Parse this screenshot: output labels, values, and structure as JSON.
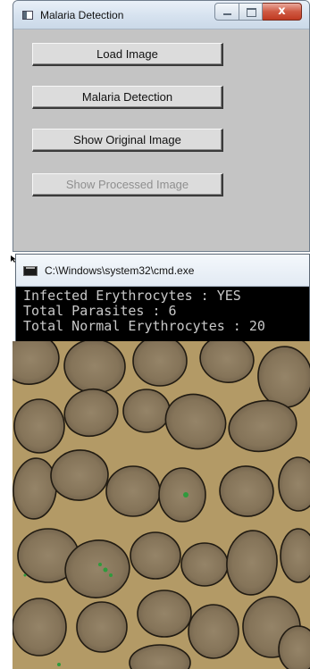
{
  "app_window": {
    "title": "Malaria Detection",
    "buttons": [
      {
        "label": "Load Image",
        "enabled": true
      },
      {
        "label": "Malaria Detection",
        "enabled": true
      },
      {
        "label": "Show Original Image",
        "enabled": true
      },
      {
        "label": "Show Processed Image",
        "enabled": false
      }
    ],
    "close_glyph": "x"
  },
  "console": {
    "title": "C:\\Windows\\system32\\cmd.exe",
    "lines": [
      "Infected Erythrocytes : YES",
      "Total Parasites : 6",
      "Total Normal Erythrocytes : 20"
    ]
  },
  "image": {
    "label": "processed-blood-smear",
    "colors": {
      "background": "#b49a64",
      "cell_fill": "#8a7a62",
      "cell_outline": "#2a2418",
      "parasite": "#2f9a3c"
    }
  }
}
